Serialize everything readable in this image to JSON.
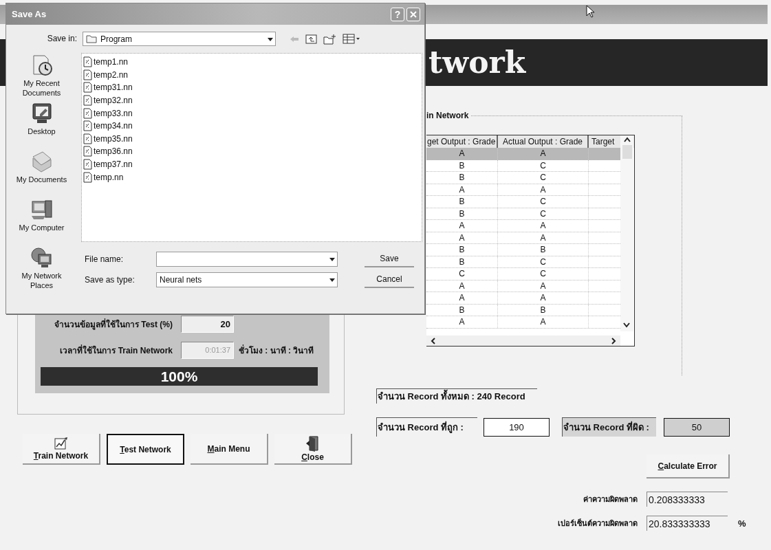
{
  "main_window": {
    "banner_title": "twork",
    "group_title": "in Network",
    "table": {
      "columns": [
        "get Output : Grade",
        "Actual Output : Grade",
        "Target"
      ],
      "rows": [
        {
          "cells": [
            "A",
            "A"
          ],
          "selected": true
        },
        {
          "cells": [
            "B",
            "C"
          ],
          "selected": false
        },
        {
          "cells": [
            "B",
            "C"
          ],
          "selected": false
        },
        {
          "cells": [
            "A",
            "A"
          ],
          "selected": false
        },
        {
          "cells": [
            "B",
            "C"
          ],
          "selected": false
        },
        {
          "cells": [
            "B",
            "C"
          ],
          "selected": false
        },
        {
          "cells": [
            "A",
            "A"
          ],
          "selected": false
        },
        {
          "cells": [
            "A",
            "A"
          ],
          "selected": false
        },
        {
          "cells": [
            "B",
            "B"
          ],
          "selected": false
        },
        {
          "cells": [
            "B",
            "C"
          ],
          "selected": false
        },
        {
          "cells": [
            "C",
            "C"
          ],
          "selected": false
        },
        {
          "cells": [
            "A",
            "A"
          ],
          "selected": false
        },
        {
          "cells": [
            "A",
            "A"
          ],
          "selected": false
        },
        {
          "cells": [
            "B",
            "B"
          ],
          "selected": false
        },
        {
          "cells": [
            "A",
            "A"
          ],
          "selected": false
        }
      ]
    },
    "test_share": {
      "label": "จำนวนข้อมูลที่ใช้ในการ Test (%)",
      "value": "20"
    },
    "train_time": {
      "label": "เวลาที่ใช้ในการ Train Network",
      "value": "0:01:37",
      "disabled": true,
      "unit": "ชั่วโมง : นาที : วินาที"
    },
    "progress": {
      "level": 1,
      "text": "100%"
    },
    "buttons": [
      {
        "label": "Train Network",
        "first_letter_underlined": true,
        "kind": "icon",
        "default": false
      },
      {
        "label": "Test Network",
        "first_letter_underlined": true,
        "kind": "text",
        "default": true
      },
      {
        "label": "Main Menu",
        "first_letter_underlined": true,
        "kind": "text",
        "default": false
      },
      {
        "label": "Close",
        "first_letter_underlined": true,
        "kind": "icon",
        "default": false
      }
    ],
    "records_total": "จำนวน Record ทั้งหมด : 240  Record",
    "records_correct": {
      "label": "จำนวน Record ที่ถูก :",
      "value": "190"
    },
    "records_wrong": {
      "label": "จำนวน Record ที่ผิด :",
      "value": "50"
    },
    "calculate_button": {
      "label": "Calculate Error",
      "first_letter_underlined": true
    },
    "error_value": {
      "label": "ค่าความผิดพลาด",
      "value": "0.208333333"
    },
    "error_percent": {
      "label": "เปอร์เซ็นต์ความผิดพลาด",
      "value": "20.833333333",
      "unit": "%"
    }
  },
  "save_dialog": {
    "title": "Save As",
    "help_button": "?",
    "save_in": {
      "label": "Save in:",
      "value": "Program"
    },
    "places": [
      "My Recent Documents",
      "Desktop",
      "My Documents",
      "My Computer",
      "My Network Places"
    ],
    "files": [
      "temp1.nn",
      "temp2.nn",
      "temp31.nn",
      "temp32.nn",
      "temp33.nn",
      "temp34.nn",
      "temp35.nn",
      "temp36.nn",
      "temp37.nn",
      "temp.nn"
    ],
    "file_name": {
      "label": "File name:"
    },
    "save_as_type": {
      "label": "Save as type:",
      "value": "Neural nets"
    },
    "buttons": [
      "Save",
      "Cancel"
    ]
  }
}
